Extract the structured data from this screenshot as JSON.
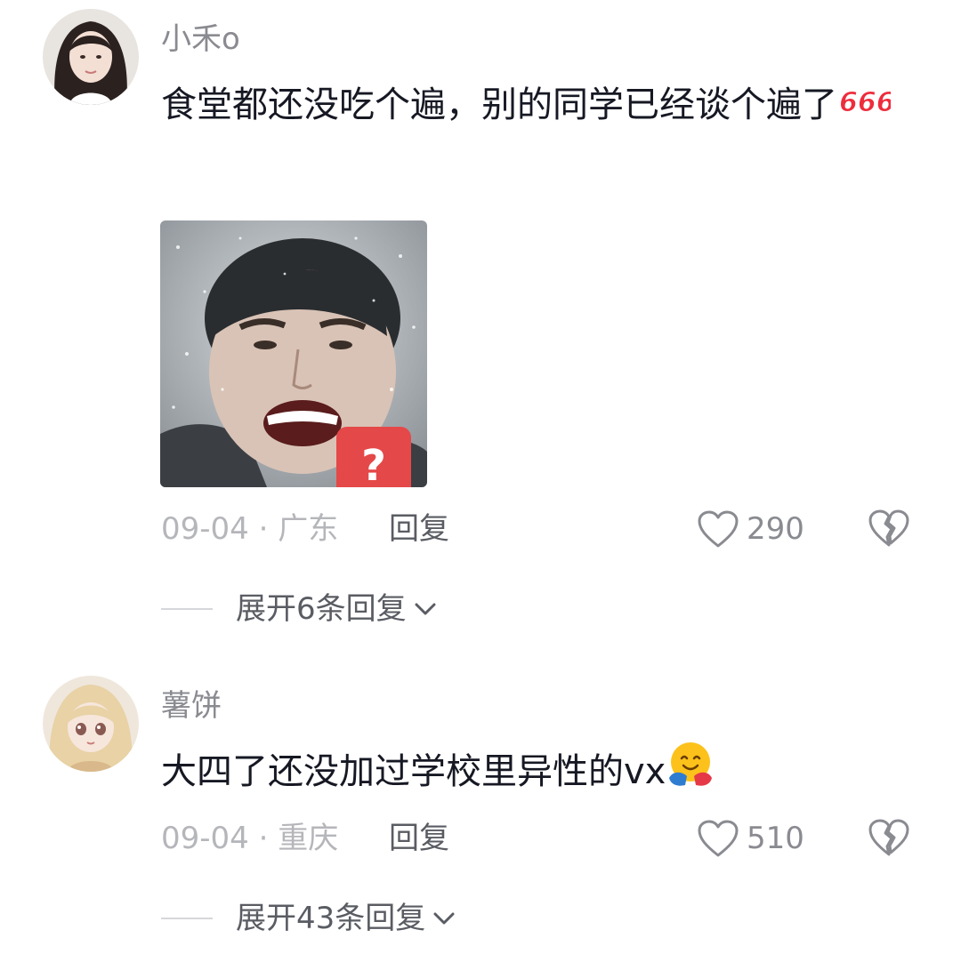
{
  "comments": [
    {
      "username": "小禾o",
      "text": "食堂都还没吃个遍，别的同学已经谈个遍了",
      "sticker": "666",
      "image_icon": "meme-photo",
      "date_location": "09-04 · 广东",
      "reply_label": "回复",
      "like_count": "290",
      "expand_label": "展开6条回复"
    },
    {
      "username": "薯饼",
      "text": "大四了还没加过学校里异性的vx",
      "emoji": "🤗",
      "date_location": "09-04 · 重庆",
      "reply_label": "回复",
      "like_count": "510",
      "expand_label": "展开43条回复"
    }
  ],
  "colors": {
    "username": "#8a8b91",
    "text": "#161823",
    "meta": "#b5b6ba",
    "reply": "#5a5c63",
    "sticker_red": "#ee2c3c"
  }
}
